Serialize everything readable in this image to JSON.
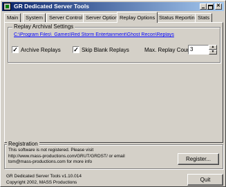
{
  "window": {
    "title": "GR Dedicated Server Tools"
  },
  "tabs": [
    {
      "label": "Main"
    },
    {
      "label": "System"
    },
    {
      "label": "Server Control"
    },
    {
      "label": "Server Options"
    },
    {
      "label": "Replay Options",
      "active": true
    },
    {
      "label": "Status Reporting"
    },
    {
      "label": "Stats"
    }
  ],
  "replay_settings": {
    "group_label": "Replay Archival Settings",
    "path": "C:\\Program Files\\_Games\\Red Storm Entertainment\\Ghost Recon\\Replays",
    "archive_replays": {
      "label": "Archive Replays",
      "checked": true,
      "mark": "✓"
    },
    "skip_blank_replays": {
      "label": "Skip Blank Replays",
      "checked": true,
      "mark": "✓"
    },
    "max_replay_count": {
      "label": "Max. Replay Count",
      "value": "3"
    }
  },
  "registration": {
    "group_label": "Registration",
    "message_lines": [
      "This software is not registered. Please visit",
      "http://www.mass-productions.com/GRUT/GRDST/ or email",
      "tom@mass-productions.com for more info"
    ],
    "register_button": "Register..."
  },
  "footer": {
    "version": "GR Dedicated Server Tools v1.10.014",
    "copyright": "Copyright 2002, MASS Productions",
    "quit_button": "Quit"
  }
}
